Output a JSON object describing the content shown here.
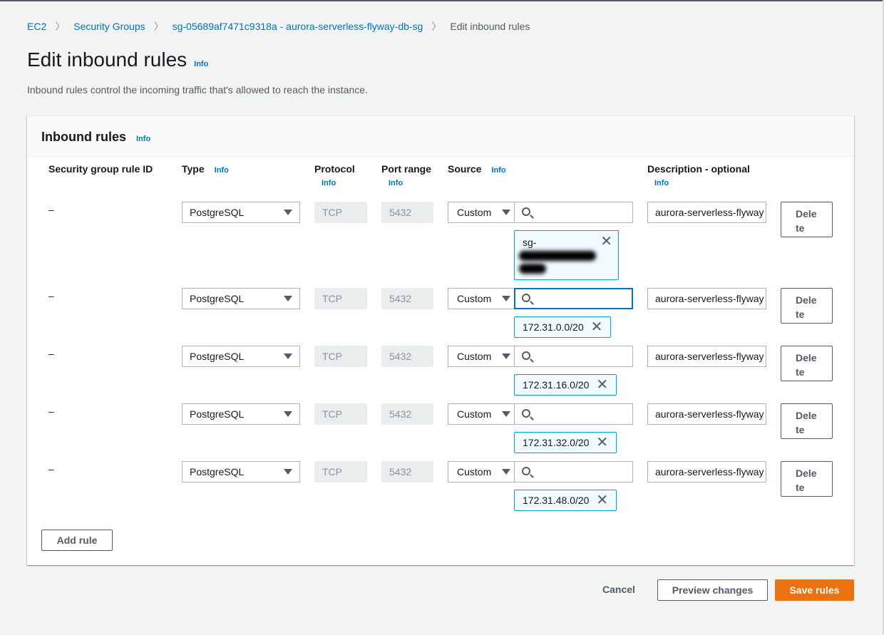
{
  "breadcrumb": {
    "items": [
      "EC2",
      "Security Groups",
      "sg-05689af7471c9318a - aurora-serverless-flyway-db-sg"
    ],
    "current": "Edit inbound rules"
  },
  "page": {
    "title": "Edit inbound rules",
    "info": "Info",
    "description": "Inbound rules control the incoming traffic that's allowed to reach the instance."
  },
  "panel": {
    "title": "Inbound rules",
    "info": "Info",
    "columns": {
      "rule_id": "Security group rule ID",
      "type": "Type",
      "protocol": "Protocol",
      "port_range": "Port range",
      "source": "Source",
      "description": "Description - optional",
      "info": "Info"
    }
  },
  "rules": [
    {
      "rule_id": "–",
      "type": "PostgreSQL",
      "protocol": "TCP",
      "port": "5432",
      "source_type": "Custom",
      "search_value": "",
      "token": "sg-",
      "token_redacted": true,
      "description": "aurora-serverless-flyway",
      "delete": [
        "Dele",
        "te"
      ]
    },
    {
      "rule_id": "–",
      "type": "PostgreSQL",
      "protocol": "TCP",
      "port": "5432",
      "source_type": "Custom",
      "search_value": "",
      "token": "172.31.0.0/20",
      "focused": true,
      "description": "aurora-serverless-flyway",
      "delete": [
        "Dele",
        "te"
      ]
    },
    {
      "rule_id": "–",
      "type": "PostgreSQL",
      "protocol": "TCP",
      "port": "5432",
      "source_type": "Custom",
      "search_value": "",
      "token": "172.31.16.0/20",
      "description": "aurora-serverless-flyway",
      "delete": [
        "Dele",
        "te"
      ]
    },
    {
      "rule_id": "–",
      "type": "PostgreSQL",
      "protocol": "TCP",
      "port": "5432",
      "source_type": "Custom",
      "search_value": "",
      "token": "172.31.32.0/20",
      "description": "aurora-serverless-flyway",
      "delete": [
        "Dele",
        "te"
      ]
    },
    {
      "rule_id": "–",
      "type": "PostgreSQL",
      "protocol": "TCP",
      "port": "5432",
      "source_type": "Custom",
      "search_value": "",
      "token": "172.31.48.0/20",
      "description": "aurora-serverless-flyway",
      "delete": [
        "Dele",
        "te"
      ]
    }
  ],
  "actions": {
    "add_rule": "Add rule",
    "cancel": "Cancel",
    "preview": "Preview changes",
    "save": "Save rules"
  },
  "colors": {
    "link": "#0073bb",
    "primary": "#ec7211",
    "token_border": "#00a1c9",
    "token_bg": "#f1faff"
  }
}
